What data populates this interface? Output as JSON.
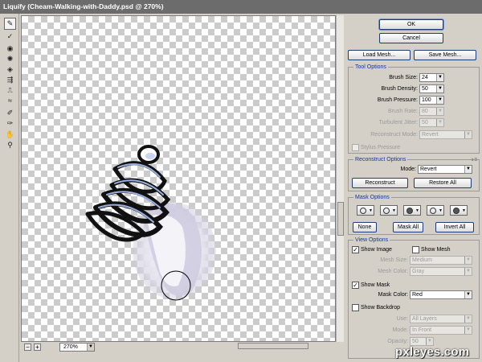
{
  "window": {
    "title": "Liquify (Cheam-Walking-with-Daddy.psd @ 270%)"
  },
  "tools": [
    "forward-warp-icon",
    "reconstruct-icon",
    "twirl-icon",
    "pucker-icon",
    "bloat-icon",
    "push-left-icon",
    "mirror-icon",
    "turbulence-icon",
    "freeze-mask-icon",
    "thaw-mask-icon",
    "hand-icon",
    "zoom-icon"
  ],
  "zoom": {
    "value": "270%",
    "minus": "−",
    "plus": "+"
  },
  "buttons": {
    "ok": "OK",
    "cancel": "Cancel",
    "load_mesh": "Load Mesh...",
    "save_mesh": "Save Mesh..."
  },
  "tool_options": {
    "title": "Tool Options",
    "brush_size_label": "Brush Size:",
    "brush_size": "24",
    "brush_density_label": "Brush Density:",
    "brush_density": "50",
    "brush_pressure_label": "Brush Pressure:",
    "brush_pressure": "100",
    "brush_rate_label": "Brush Rate:",
    "brush_rate": "80",
    "turbulent_jitter_label": "Turbulent Jitter:",
    "turbulent_jitter": "50",
    "reconstruct_mode_label": "Reconstruct Mode:",
    "reconstruct_mode": "Revert",
    "stylus_pressure": "Stylus Pressure"
  },
  "reconstruct_options": {
    "title": "Reconstruct Options",
    "mode_label": "Mode:",
    "mode": "Revert",
    "reconstruct": "Reconstruct",
    "restore_all": "Restore All"
  },
  "mask_options": {
    "title": "Mask Options",
    "none": "None",
    "mask_all": "Mask All",
    "invert_all": "Invert All"
  },
  "view_options": {
    "title": "View Options",
    "show_image": "Show Image",
    "show_image_checked": true,
    "show_mesh": "Show Mesh",
    "show_mesh_checked": false,
    "mesh_size_label": "Mesh Size:",
    "mesh_size": "Medium",
    "mesh_color_label": "Mesh Color:",
    "mesh_color": "Gray",
    "show_mask": "Show Mask",
    "show_mask_checked": true,
    "mask_color_label": "Mask Color:",
    "mask_color": "Red",
    "show_backdrop": "Show Backdrop",
    "show_backdrop_checked": false,
    "use_label": "Use:",
    "use": "All Layers",
    "mode_label": "Mode:",
    "mode": "In Front",
    "opacity_label": "Opacity:",
    "opacity": "50"
  },
  "watermark": "pxleyes.com",
  "colors": {
    "titlebar": "#6c6c6c",
    "panel": "#d4d0c8",
    "group_title": "#16349a"
  }
}
